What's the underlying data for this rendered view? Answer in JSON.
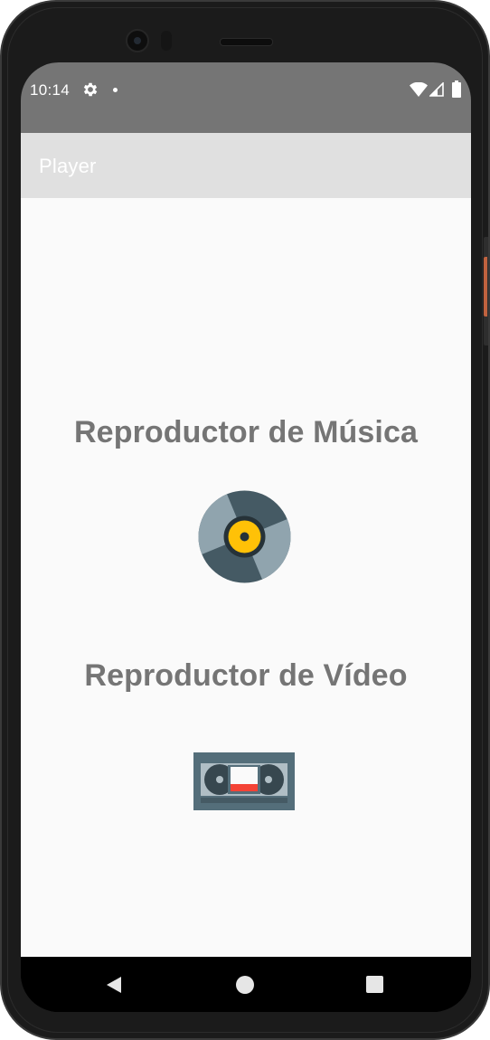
{
  "status_bar": {
    "time": "10:14",
    "icons": [
      "settings-gear-icon",
      "notification-dot-icon",
      "wifi-icon",
      "cell-signal-icon",
      "battery-icon"
    ]
  },
  "app_bar": {
    "title": "Player"
  },
  "main": {
    "music": {
      "title": "Reproductor de Música",
      "icon": "vinyl-record-icon"
    },
    "video": {
      "title": "Reproductor de Vídeo",
      "icon": "vhs-cassette-icon"
    }
  },
  "nav_bar": {
    "buttons": [
      "back-icon",
      "home-icon",
      "recents-icon"
    ]
  },
  "colors": {
    "status_bar": "#757575",
    "app_bar": "#e0e0e0",
    "content_bg": "#fafafa",
    "title_text": "#757575",
    "vinyl_body": "#455a64",
    "vinyl_label": "#ffc107",
    "vhs_body": "#546e7a",
    "vhs_red": "#f44336"
  }
}
